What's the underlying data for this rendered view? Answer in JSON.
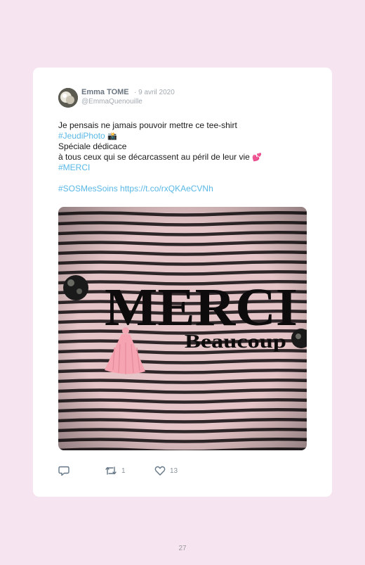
{
  "tweet": {
    "author_name": "Emma TOME",
    "date": "· 9 avril 2020",
    "handle": "@EmmaQuenouille",
    "lines": {
      "line1": "Je pensais ne jamais pouvoir mettre ce tee-shirt",
      "hashtag_jeudiphoto": "#JeudiPhoto",
      "emoji_camera": "📸",
      "line3": "Spéciale dédicace",
      "line4": "à tous ceux qui se décarcassent au péril de leur vie",
      "emoji_hearts": "💕",
      "hashtag_merci": "#MERCI",
      "hashtag_sosmessoins": "#SOSMesSoins",
      "url": "https://t.co/rxQKAeCVNh"
    },
    "photo": {
      "shirt_text_main": "MERCI",
      "shirt_text_sub": "Beaucoup"
    },
    "actions": {
      "retweet_count": "1",
      "like_count": "13"
    }
  },
  "colors": {
    "page_background": "#f6e5f0",
    "link": "#59b8e6",
    "stripe_pink": "#e7c8c9",
    "stripe_dark": "#2b2426"
  },
  "icons": [
    "reply-icon",
    "retweet-icon",
    "heart-icon"
  ],
  "page": {
    "number": "27"
  }
}
